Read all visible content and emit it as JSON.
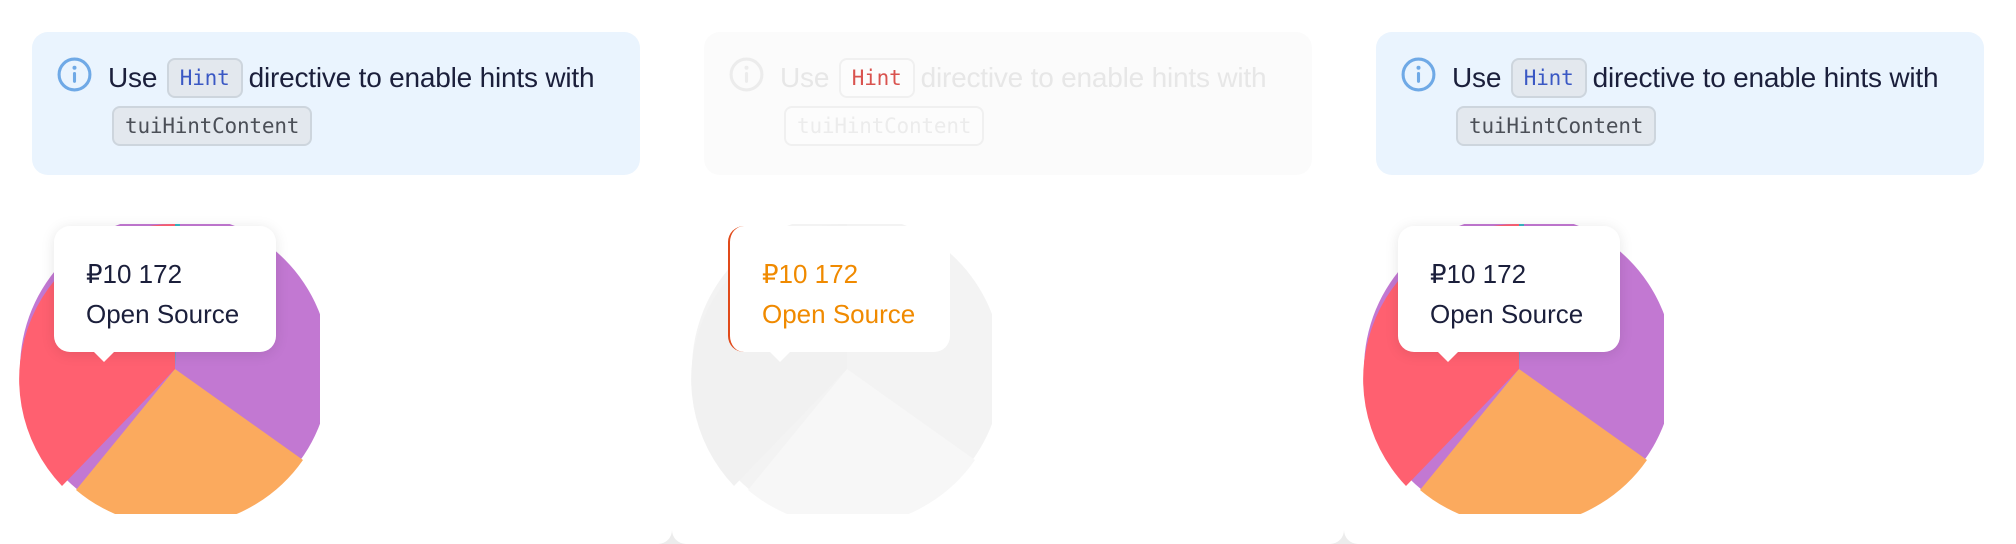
{
  "panels": [
    {
      "notice": {
        "use": "Use",
        "hint_code": "Hint",
        "middle": "directive to enable hints with",
        "content_code": "tuiHintContent"
      },
      "tooltip": {
        "amount": "₽10 172",
        "label": "Open Source"
      }
    },
    {
      "notice": {
        "use": "Use",
        "hint_code": "Hint",
        "middle": "directive to enable hints with",
        "content_code": "tuiHintContent"
      },
      "tooltip": {
        "amount": "₽10 172",
        "label": "Open Source"
      }
    },
    {
      "notice": {
        "use": "Use",
        "hint_code": "Hint",
        "middle": "directive to enable hints with",
        "content_code": "tuiHintContent"
      },
      "tooltip": {
        "amount": "₽10 172",
        "label": "Open Source"
      }
    }
  ],
  "colors": {
    "info_icon": "#6fa9e6",
    "segment_red": "#ff6070",
    "segment_orange": "#fbaa5e",
    "segment_purple": "#c278d2",
    "segment_teal": "#3ab5c2",
    "faded_pie": "#f3f3f3"
  },
  "icons": {
    "info": "info-circle-icon"
  }
}
